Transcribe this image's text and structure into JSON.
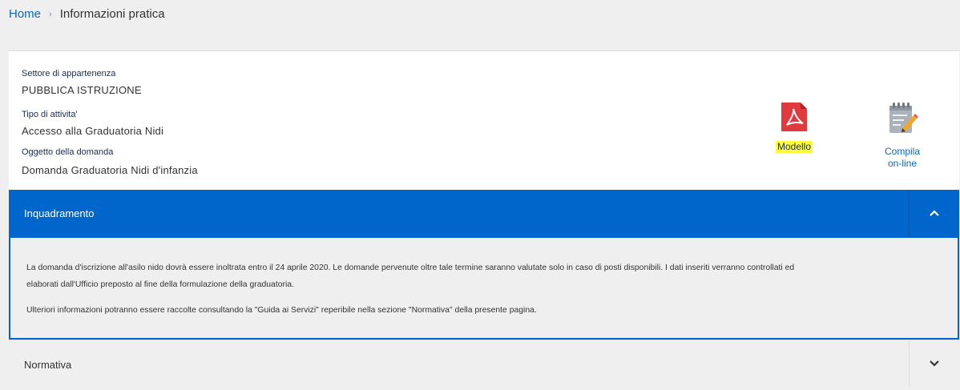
{
  "breadcrumb": {
    "home": "Home",
    "separator": "›",
    "current": "Informazioni pratica"
  },
  "info": {
    "settore_label": "Settore di appartenenza",
    "settore_value": "PUBBLICA ISTRUZIONE",
    "tipo_label": "Tipo di attivita'",
    "tipo_value": "Accesso alla Graduatoria Nidi",
    "oggetto_label": "Oggetto della domanda",
    "oggetto_value": "Domanda Graduatoria Nidi d'infanzia"
  },
  "actions": {
    "modello_label": "Modello",
    "compila_label_line1": "Compila",
    "compila_label_line2": "on-line"
  },
  "accordion": {
    "inquadramento_title": "Inquadramento",
    "inquadramento_expanded": true,
    "paragraph1_line1": "La domanda d'iscrizione all'asilo nido dovrà essere inoltrata entro il 24 aprile 2020. Le domande pervenute oltre tale termine saranno valutate solo in caso di posti disponibili. I dati inseriti verranno controllati ed",
    "paragraph1_line2": "elaborati dall'Ufficio preposto al fine della formulazione della graduatoria.",
    "paragraph2": "Ulteriori informazioni potranno essere raccolte consultando la \"Guida ai Servizi\" reperibile nella sezione \"Normativa\" della presente pagina.",
    "normativa_title": "Normativa",
    "normativa_expanded": false
  },
  "colors": {
    "primary": "#0066cc",
    "link": "#0a66c2",
    "highlight": "#ffff3a",
    "pdf_icon": "#e03a3e"
  },
  "icons": {
    "modello": "pdf-file-icon",
    "compila": "notepad-pencil-icon",
    "inquadramento_toggle": "chevron-up-icon",
    "normativa_toggle": "chevron-down-icon"
  }
}
